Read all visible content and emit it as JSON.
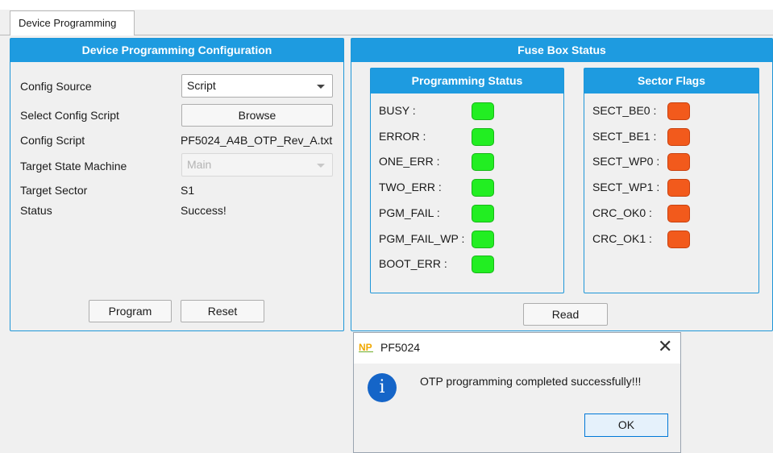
{
  "tab": {
    "label": "Device Programming"
  },
  "config_panel": {
    "title": "Device Programming Configuration",
    "rows": {
      "config_source_label": "Config Source",
      "config_source_value": "Script",
      "select_script_label": "Select Config Script",
      "browse_label": "Browse",
      "config_script_label": "Config Script",
      "config_script_value": "PF5024_A4B_OTP_Rev_A.txt",
      "state_machine_label": "Target State Machine",
      "state_machine_value": "Main",
      "target_sector_label": "Target Sector",
      "target_sector_value": "S1",
      "status_label": "Status",
      "status_value": "Success!"
    },
    "program_label": "Program",
    "reset_label": "Reset"
  },
  "fuse_panel": {
    "title": "Fuse Box Status",
    "programming_status": {
      "title": "Programming Status",
      "items": [
        {
          "label": "BUSY :",
          "state": "ok"
        },
        {
          "label": "ERROR :",
          "state": "ok"
        },
        {
          "label": "ONE_ERR :",
          "state": "ok"
        },
        {
          "label": "TWO_ERR :",
          "state": "ok"
        },
        {
          "label": "PGM_FAIL :",
          "state": "ok"
        },
        {
          "label": "PGM_FAIL_WP :",
          "state": "ok"
        },
        {
          "label": "BOOT_ERR :",
          "state": "ok"
        }
      ]
    },
    "sector_flags": {
      "title": "Sector Flags",
      "items": [
        {
          "label": "SECT_BE0 :",
          "state": "set"
        },
        {
          "label": "SECT_BE1 :",
          "state": "set"
        },
        {
          "label": "SECT_WP0 :",
          "state": "set"
        },
        {
          "label": "SECT_WP1 :",
          "state": "set"
        },
        {
          "label": "CRC_OK0 :",
          "state": "set"
        },
        {
          "label": "CRC_OK1 :",
          "state": "set"
        }
      ]
    },
    "read_label": "Read"
  },
  "dialog": {
    "title": "PF5024",
    "logo_text": "NP",
    "message": "OTP programming completed successfully!!!",
    "ok_label": "OK",
    "close_icon": "close-icon",
    "info_icon": "info-icon"
  },
  "colors": {
    "accent": "#1e9be0",
    "led_green": "#22ee22",
    "led_red": "#f25a1c",
    "info_blue": "#1565c8"
  }
}
